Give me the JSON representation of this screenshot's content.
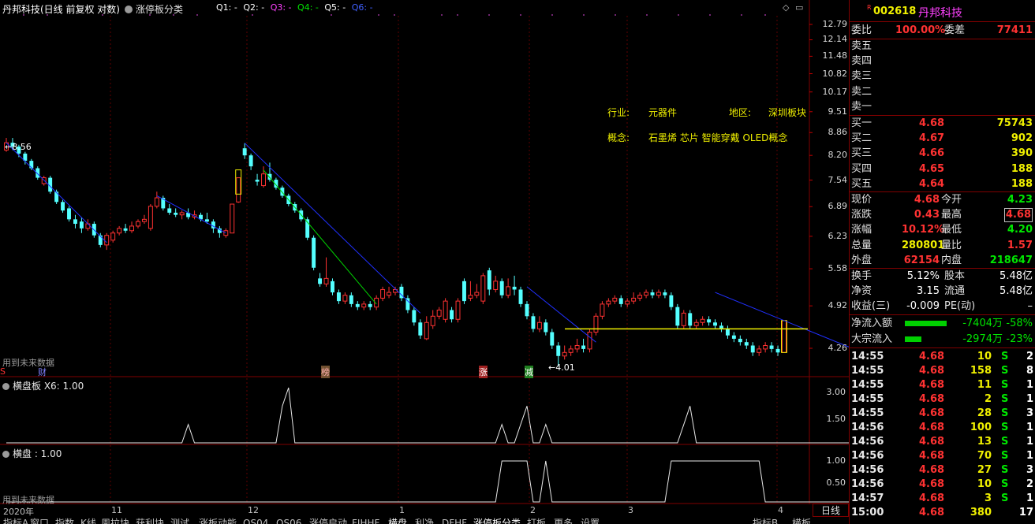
{
  "header": {
    "title": "丹邦科技(日线 前复权 对数)",
    "indicator_dropdown": "涨停板分类",
    "q1": "Q1: -",
    "q2": "Q2: -",
    "q3": "Q3: -",
    "q4": "Q4: -",
    "q5": "Q5: -"
  },
  "info": {
    "industry_label": "行业:",
    "industry_value": "元器件",
    "region_label": "地区:",
    "region_value": "深圳板块",
    "concept_label": "概念:",
    "concept_value": "石墨烯 芯片 智能穿戴 OLED概念"
  },
  "price_axis": [
    "12.79",
    "12.14",
    "11.48",
    "10.82",
    "10.17",
    "9.51",
    "8.86",
    "8.20",
    "7.54",
    "6.89",
    "6.23",
    "5.58",
    "4.92",
    "4.26"
  ],
  "annotations": {
    "high_price": "8.56",
    "low_price": "4.01",
    "future_data_1": "用到未来数据",
    "future_data_2": "用到未来数据",
    "marker_s": "S",
    "marker_cai": "财",
    "marker_bang": "榜",
    "marker_zhang": "涨",
    "marker_jian": "减"
  },
  "sub1": {
    "label": "横盘板  X6: 1.00",
    "ticks": [
      "3.00",
      "1.50"
    ],
    "values": [
      0,
      0,
      0,
      0,
      0,
      0,
      0,
      0,
      0,
      0,
      0,
      0,
      0,
      0,
      0,
      0,
      0,
      0,
      0,
      0,
      0,
      0,
      0,
      0,
      0,
      0,
      0,
      0,
      0,
      1,
      0,
      0,
      0,
      0,
      0,
      0,
      0,
      0,
      0,
      0,
      0,
      0,
      0,
      0,
      2,
      3,
      0,
      0,
      0,
      0,
      0,
      0,
      0,
      0,
      0,
      0,
      0,
      0,
      0,
      0,
      0,
      0,
      0,
      0,
      0,
      0,
      0,
      0,
      0,
      0,
      0,
      0,
      0,
      0,
      0,
      0,
      0,
      0,
      0,
      1,
      0,
      0,
      1,
      2,
      0,
      0,
      1,
      0,
      0,
      0,
      0,
      0,
      0,
      0,
      0,
      0,
      0,
      0,
      0,
      0,
      0,
      0,
      0,
      0,
      0,
      0,
      0,
      0,
      1,
      2,
      0,
      0,
      0,
      0,
      0,
      0,
      0,
      0,
      0,
      0,
      0,
      0,
      0,
      0,
      0,
      0,
      0,
      0,
      0,
      0,
      0,
      0,
      0,
      0,
      0,
      0,
      0,
      0,
      0,
      0,
      1
    ]
  },
  "sub2": {
    "label": "横盘 : 1.00",
    "ticks": [
      "1.00",
      "0.50"
    ],
    "values": [
      0,
      0,
      0,
      0,
      0,
      0,
      0,
      0,
      0,
      0,
      0,
      0,
      0,
      0,
      0,
      0,
      0,
      0,
      0,
      0,
      0,
      0,
      0,
      0,
      0,
      0,
      0,
      0,
      0,
      0,
      0,
      0,
      0,
      0,
      0,
      0,
      0,
      0,
      0,
      0,
      0,
      0,
      0,
      0,
      0,
      0,
      0,
      0,
      0,
      0,
      0,
      0,
      0,
      0,
      0,
      0,
      0,
      0,
      0,
      0,
      0,
      0,
      0,
      0,
      0,
      0,
      0,
      0,
      0,
      0,
      0,
      0,
      0,
      0,
      0,
      0,
      0,
      0,
      0,
      1,
      1,
      1,
      1,
      1,
      0,
      0,
      1,
      0,
      0,
      0,
      0,
      0,
      0,
      0,
      0,
      0,
      0,
      0,
      0,
      0,
      0,
      0,
      0,
      0,
      0,
      0,
      1,
      1,
      1,
      1,
      1,
      1,
      1,
      1,
      1,
      1,
      1,
      1,
      1,
      1,
      1,
      0,
      0,
      0,
      0,
      0,
      0,
      0,
      0,
      0,
      0,
      0,
      0,
      0,
      0,
      0,
      0,
      0,
      0,
      0,
      1,
      1
    ]
  },
  "x_axis": [
    "2020年",
    "11",
    "12",
    "1",
    "2",
    "3",
    "4"
  ],
  "tabs": [
    "指标A",
    "窗口",
    "指数",
    "K线",
    "周拉块",
    "获利块",
    "测试",
    "涨板动能",
    "QS04",
    "QS06",
    "涨停启动",
    "FJHHF",
    "横盘",
    "利净",
    "DFHF",
    "涨停板分类",
    "打板",
    "更多",
    "设置",
    "指标B",
    "横板"
  ],
  "period": "日线",
  "quote": {
    "code": "002618",
    "name": "丹邦科技",
    "r_flag": "R",
    "weibi_label": "委比",
    "weibi": "100.00%",
    "weicha_label": "委差",
    "weicha": "77411",
    "sell": [
      {
        "label": "卖五",
        "price": "",
        "vol": ""
      },
      {
        "label": "卖四",
        "price": "",
        "vol": ""
      },
      {
        "label": "卖三",
        "price": "",
        "vol": ""
      },
      {
        "label": "卖二",
        "price": "",
        "vol": ""
      },
      {
        "label": "卖一",
        "price": "",
        "vol": ""
      }
    ],
    "buy": [
      {
        "label": "买一",
        "price": "4.68",
        "vol": "75743"
      },
      {
        "label": "买二",
        "price": "4.67",
        "vol": "902"
      },
      {
        "label": "买三",
        "price": "4.66",
        "vol": "390"
      },
      {
        "label": "买四",
        "price": "4.65",
        "vol": "188"
      },
      {
        "label": "买五",
        "price": "4.64",
        "vol": "188"
      }
    ],
    "stats": [
      {
        "l1": "现价",
        "v1": "4.68",
        "l2": "今开",
        "v2": "4.23"
      },
      {
        "l1": "涨跌",
        "v1": "0.43",
        "l2": "最高",
        "v2": "4.68"
      },
      {
        "l1": "涨幅",
        "v1": "10.12%",
        "l2": "最低",
        "v2": "4.20"
      },
      {
        "l1": "总量",
        "v1": "280801",
        "l2": "量比",
        "v2": "1.57"
      },
      {
        "l1": "外盘",
        "v1": "62154",
        "l2": "内盘",
        "v2": "218647"
      }
    ],
    "fund": [
      {
        "l1": "换手",
        "v1": "5.12%",
        "l2": "股本",
        "v2": "5.48亿"
      },
      {
        "l1": "净资",
        "v1": "3.15",
        "l2": "流通",
        "v2": "5.48亿"
      },
      {
        "l1": "收益(三)",
        "v1": "-0.009",
        "l2": "PE(动)",
        "v2": "–"
      }
    ],
    "flow": [
      {
        "label": "净流入额",
        "value": "-7404万",
        "pct": "-58%",
        "bar": 0.58
      },
      {
        "label": "大宗流入",
        "value": "-2974万",
        "pct": "-23%",
        "bar": 0.23
      }
    ],
    "ticks": [
      {
        "t": "14:55",
        "p": "4.68",
        "v": "10",
        "s": "S",
        "n": "2"
      },
      {
        "t": "14:55",
        "p": "4.68",
        "v": "158",
        "s": "S",
        "n": "8"
      },
      {
        "t": "14:55",
        "p": "4.68",
        "v": "11",
        "s": "S",
        "n": "1"
      },
      {
        "t": "14:55",
        "p": "4.68",
        "v": "2",
        "s": "S",
        "n": "1"
      },
      {
        "t": "14:55",
        "p": "4.68",
        "v": "28",
        "s": "S",
        "n": "3"
      },
      {
        "t": "14:56",
        "p": "4.68",
        "v": "100",
        "s": "S",
        "n": "1"
      },
      {
        "t": "14:56",
        "p": "4.68",
        "v": "13",
        "s": "S",
        "n": "1"
      },
      {
        "t": "14:56",
        "p": "4.68",
        "v": "70",
        "s": "S",
        "n": "1"
      },
      {
        "t": "14:56",
        "p": "4.68",
        "v": "27",
        "s": "S",
        "n": "3"
      },
      {
        "t": "14:56",
        "p": "4.68",
        "v": "10",
        "s": "S",
        "n": "2"
      },
      {
        "t": "14:57",
        "p": "4.68",
        "v": "3",
        "s": "S",
        "n": "1"
      },
      {
        "t": "15:00",
        "p": "4.68",
        "v": "380",
        "s": "",
        "n": "17"
      }
    ]
  },
  "candles": [
    {
      "o": 8.35,
      "c": 8.56,
      "h": 8.7,
      "l": 8.3
    },
    {
      "o": 8.56,
      "c": 8.45,
      "h": 8.7,
      "l": 8.35
    },
    {
      "o": 8.45,
      "c": 8.25,
      "h": 8.5,
      "l": 8.15
    },
    {
      "o": 8.25,
      "c": 8.05,
      "h": 8.3,
      "l": 7.95
    },
    {
      "o": 8.05,
      "c": 7.85,
      "h": 8.1,
      "l": 7.8
    },
    {
      "o": 7.85,
      "c": 7.6,
      "h": 7.9,
      "l": 7.55
    },
    {
      "o": 7.45,
      "c": 7.6,
      "h": 7.65,
      "l": 7.4
    },
    {
      "o": 7.6,
      "c": 7.25,
      "h": 7.65,
      "l": 7.2
    },
    {
      "o": 7.25,
      "c": 7.0,
      "h": 7.3,
      "l": 6.95
    },
    {
      "o": 7.0,
      "c": 6.8,
      "h": 7.05,
      "l": 6.75
    },
    {
      "o": 6.85,
      "c": 6.6,
      "h": 6.9,
      "l": 6.55
    },
    {
      "o": 6.6,
      "c": 6.5,
      "h": 6.7,
      "l": 6.4
    },
    {
      "o": 6.55,
      "c": 6.4,
      "h": 6.65,
      "l": 6.3
    },
    {
      "o": 6.4,
      "c": 6.5,
      "h": 6.6,
      "l": 6.35
    },
    {
      "o": 6.5,
      "c": 6.25,
      "h": 6.55,
      "l": 6.2
    },
    {
      "o": 6.25,
      "c": 6.05,
      "h": 6.3,
      "l": 6.0
    },
    {
      "o": 6.05,
      "c": 6.25,
      "h": 6.3,
      "l": 5.95
    },
    {
      "o": 6.15,
      "c": 6.3,
      "h": 6.35,
      "l": 6.1
    },
    {
      "o": 6.3,
      "c": 6.4,
      "h": 6.45,
      "l": 6.25
    },
    {
      "o": 6.4,
      "c": 6.35,
      "h": 6.5,
      "l": 6.3
    },
    {
      "o": 6.35,
      "c": 6.45,
      "h": 6.55,
      "l": 6.3
    },
    {
      "o": 6.45,
      "c": 6.55,
      "h": 6.6,
      "l": 6.4
    },
    {
      "o": 6.55,
      "c": 6.6,
      "h": 6.7,
      "l": 6.5
    },
    {
      "o": 6.4,
      "c": 6.9,
      "h": 6.95,
      "l": 6.35
    },
    {
      "o": 6.9,
      "c": 7.1,
      "h": 7.25,
      "l": 6.85
    },
    {
      "o": 7.1,
      "c": 6.85,
      "h": 7.15,
      "l": 6.8
    },
    {
      "o": 6.85,
      "c": 6.75,
      "h": 6.95,
      "l": 6.7
    },
    {
      "o": 6.75,
      "c": 6.7,
      "h": 6.85,
      "l": 6.65
    },
    {
      "o": 6.7,
      "c": 6.75,
      "h": 6.8,
      "l": 6.6
    },
    {
      "o": 6.75,
      "c": 6.65,
      "h": 6.85,
      "l": 6.6
    },
    {
      "o": 6.65,
      "c": 6.7,
      "h": 6.8,
      "l": 6.6
    },
    {
      "o": 6.7,
      "c": 6.6,
      "h": 6.75,
      "l": 6.55
    },
    {
      "o": 6.6,
      "c": 6.55,
      "h": 6.75,
      "l": 6.5
    },
    {
      "o": 6.55,
      "c": 6.4,
      "h": 6.6,
      "l": 6.3
    },
    {
      "o": 6.4,
      "c": 6.3,
      "h": 6.45,
      "l": 6.2
    },
    {
      "o": 6.25,
      "c": 6.35,
      "h": 6.4,
      "l": 6.2
    },
    {
      "o": 6.3,
      "c": 6.95,
      "h": 6.95,
      "l": 6.3
    },
    {
      "o": 7.0,
      "c": 7.6,
      "h": 7.6,
      "l": 6.98
    },
    {
      "o": 8.4,
      "c": 8.2,
      "h": 8.55,
      "l": 8.1
    },
    {
      "o": 8.2,
      "c": 7.9,
      "h": 8.25,
      "l": 7.8
    },
    {
      "o": 7.55,
      "c": 7.5,
      "h": 7.7,
      "l": 7.4
    },
    {
      "o": 7.4,
      "c": 7.7,
      "h": 7.9,
      "l": 7.35
    },
    {
      "o": 7.7,
      "c": 7.55,
      "h": 8.0,
      "l": 7.5
    },
    {
      "o": 7.55,
      "c": 7.35,
      "h": 7.6,
      "l": 7.3
    },
    {
      "o": 7.35,
      "c": 7.15,
      "h": 7.4,
      "l": 7.1
    },
    {
      "o": 7.15,
      "c": 6.95,
      "h": 7.2,
      "l": 6.9
    },
    {
      "o": 6.95,
      "c": 6.8,
      "h": 7.0,
      "l": 6.75
    },
    {
      "o": 6.8,
      "c": 6.6,
      "h": 6.85,
      "l": 6.55
    },
    {
      "o": 6.6,
      "c": 6.2,
      "h": 6.65,
      "l": 6.15
    },
    {
      "o": 6.2,
      "c": 5.6,
      "h": 6.25,
      "l": 5.55
    },
    {
      "o": 5.4,
      "c": 5.3,
      "h": 5.5,
      "l": 5.25
    },
    {
      "o": 5.3,
      "c": 5.4,
      "h": 5.8,
      "l": 5.25
    },
    {
      "o": 5.35,
      "c": 5.15,
      "h": 5.4,
      "l": 5.1
    },
    {
      "o": 5.15,
      "c": 5.0,
      "h": 5.2,
      "l": 4.95
    },
    {
      "o": 5.0,
      "c": 5.1,
      "h": 5.15,
      "l": 4.95
    },
    {
      "o": 5.1,
      "c": 4.95,
      "h": 5.15,
      "l": 4.9
    },
    {
      "o": 4.95,
      "c": 4.9,
      "h": 5.0,
      "l": 4.85
    },
    {
      "o": 4.9,
      "c": 4.95,
      "h": 5.0,
      "l": 4.85
    },
    {
      "o": 4.95,
      "c": 4.9,
      "h": 5.0,
      "l": 4.85
    },
    {
      "o": 4.9,
      "c": 5.05,
      "h": 5.1,
      "l": 4.85
    },
    {
      "o": 5.05,
      "c": 5.2,
      "h": 5.25,
      "l": 5.0
    },
    {
      "o": 5.1,
      "c": 5.15,
      "h": 5.25,
      "l": 5.05
    },
    {
      "o": 5.15,
      "c": 5.2,
      "h": 5.25,
      "l": 5.1
    },
    {
      "o": 5.25,
      "c": 5.05,
      "h": 5.3,
      "l": 5.0
    },
    {
      "o": 5.05,
      "c": 4.85,
      "h": 5.1,
      "l": 4.8
    },
    {
      "o": 4.85,
      "c": 4.65,
      "h": 4.9,
      "l": 4.6
    },
    {
      "o": 4.65,
      "c": 4.45,
      "h": 4.7,
      "l": 4.4
    },
    {
      "o": 4.4,
      "c": 4.65,
      "h": 4.75,
      "l": 4.38
    },
    {
      "o": 4.6,
      "c": 4.75,
      "h": 4.85,
      "l": 4.55
    },
    {
      "o": 4.75,
      "c": 4.85,
      "h": 4.9,
      "l": 4.7
    },
    {
      "o": 4.7,
      "c": 5.0,
      "h": 5.05,
      "l": 4.65
    },
    {
      "o": 4.85,
      "c": 4.7,
      "h": 4.9,
      "l": 4.65
    },
    {
      "o": 4.7,
      "c": 5.0,
      "h": 5.05,
      "l": 4.65
    },
    {
      "o": 5.35,
      "c": 5.0,
      "h": 5.4,
      "l": 4.95
    },
    {
      "o": 5.05,
      "c": 5.1,
      "h": 5.35,
      "l": 5.0
    },
    {
      "o": 5.1,
      "c": 5.15,
      "h": 5.3,
      "l": 5.05
    },
    {
      "o": 5.0,
      "c": 5.45,
      "h": 5.5,
      "l": 4.95
    },
    {
      "o": 5.55,
      "c": 5.2,
      "h": 5.6,
      "l": 5.1
    },
    {
      "o": 5.2,
      "c": 5.35,
      "h": 5.45,
      "l": 5.15
    },
    {
      "o": 5.35,
      "c": 5.1,
      "h": 5.4,
      "l": 5.05
    },
    {
      "o": 5.1,
      "c": 5.25,
      "h": 5.4,
      "l": 5.05
    },
    {
      "o": 5.25,
      "c": 5.2,
      "h": 5.45,
      "l": 5.1
    },
    {
      "o": 5.2,
      "c": 4.95,
      "h": 5.25,
      "l": 4.9
    },
    {
      "o": 4.95,
      "c": 4.75,
      "h": 5.0,
      "l": 4.7
    },
    {
      "o": 4.75,
      "c": 4.55,
      "h": 4.8,
      "l": 4.5
    },
    {
      "o": 4.55,
      "c": 4.65,
      "h": 4.75,
      "l": 4.5
    },
    {
      "o": 4.65,
      "c": 4.5,
      "h": 4.7,
      "l": 4.45
    },
    {
      "o": 4.5,
      "c": 4.3,
      "h": 4.55,
      "l": 4.25
    },
    {
      "o": 4.3,
      "c": 4.15,
      "h": 4.35,
      "l": 4.01
    },
    {
      "o": 4.15,
      "c": 4.2,
      "h": 4.3,
      "l": 4.1
    },
    {
      "o": 4.2,
      "c": 4.25,
      "h": 4.3,
      "l": 4.15
    },
    {
      "o": 4.25,
      "c": 4.3,
      "h": 4.4,
      "l": 4.2
    },
    {
      "o": 4.3,
      "c": 4.25,
      "h": 4.4,
      "l": 4.2
    },
    {
      "o": 4.25,
      "c": 4.5,
      "h": 4.55,
      "l": 4.2
    },
    {
      "o": 4.5,
      "c": 4.75,
      "h": 4.8,
      "l": 4.45
    },
    {
      "o": 4.75,
      "c": 4.95,
      "h": 5.0,
      "l": 4.7
    },
    {
      "o": 4.95,
      "c": 5.0,
      "h": 5.05,
      "l": 4.9
    },
    {
      "o": 5.0,
      "c": 5.05,
      "h": 5.1,
      "l": 4.95
    },
    {
      "o": 5.05,
      "c": 4.95,
      "h": 5.1,
      "l": 4.9
    },
    {
      "o": 4.95,
      "c": 5.0,
      "h": 5.05,
      "l": 4.9
    },
    {
      "o": 5.0,
      "c": 5.05,
      "h": 5.15,
      "l": 4.95
    },
    {
      "o": 5.05,
      "c": 5.1,
      "h": 5.15,
      "l": 5.0
    },
    {
      "o": 5.1,
      "c": 5.15,
      "h": 5.2,
      "l": 5.05
    },
    {
      "o": 5.15,
      "c": 5.1,
      "h": 5.2,
      "l": 5.05
    },
    {
      "o": 5.1,
      "c": 5.15,
      "h": 5.2,
      "l": 5.05
    },
    {
      "o": 5.15,
      "c": 5.1,
      "h": 5.2,
      "l": 5.05
    },
    {
      "o": 5.1,
      "c": 4.9,
      "h": 5.15,
      "l": 4.85
    },
    {
      "o": 4.9,
      "c": 4.6,
      "h": 4.95,
      "l": 4.55
    },
    {
      "o": 4.6,
      "c": 4.8,
      "h": 4.85,
      "l": 4.55
    },
    {
      "o": 4.8,
      "c": 4.6,
      "h": 4.85,
      "l": 4.55
    },
    {
      "o": 4.6,
      "c": 4.65,
      "h": 4.7,
      "l": 4.55
    },
    {
      "o": 4.65,
      "c": 4.7,
      "h": 4.75,
      "l": 4.6
    },
    {
      "o": 4.7,
      "c": 4.65,
      "h": 4.75,
      "l": 4.6
    },
    {
      "o": 4.65,
      "c": 4.6,
      "h": 4.7,
      "l": 4.55
    },
    {
      "o": 4.6,
      "c": 4.55,
      "h": 4.65,
      "l": 4.5
    },
    {
      "o": 4.55,
      "c": 4.45,
      "h": 4.6,
      "l": 4.4
    },
    {
      "o": 4.45,
      "c": 4.4,
      "h": 4.5,
      "l": 4.35
    },
    {
      "o": 4.4,
      "c": 4.35,
      "h": 4.45,
      "l": 4.3
    },
    {
      "o": 4.35,
      "c": 4.3,
      "h": 4.4,
      "l": 4.25
    },
    {
      "o": 4.3,
      "c": 4.2,
      "h": 4.35,
      "l": 4.15
    },
    {
      "o": 4.2,
      "c": 4.25,
      "h": 4.3,
      "l": 4.15
    },
    {
      "o": 4.25,
      "c": 4.3,
      "h": 4.35,
      "l": 4.2
    },
    {
      "o": 4.3,
      "c": 4.25,
      "h": 4.35,
      "l": 4.2
    },
    {
      "o": 4.25,
      "c": 4.2,
      "h": 4.3,
      "l": 4.15
    },
    {
      "o": 4.2,
      "c": 4.68,
      "h": 4.68,
      "l": 4.2
    }
  ]
}
